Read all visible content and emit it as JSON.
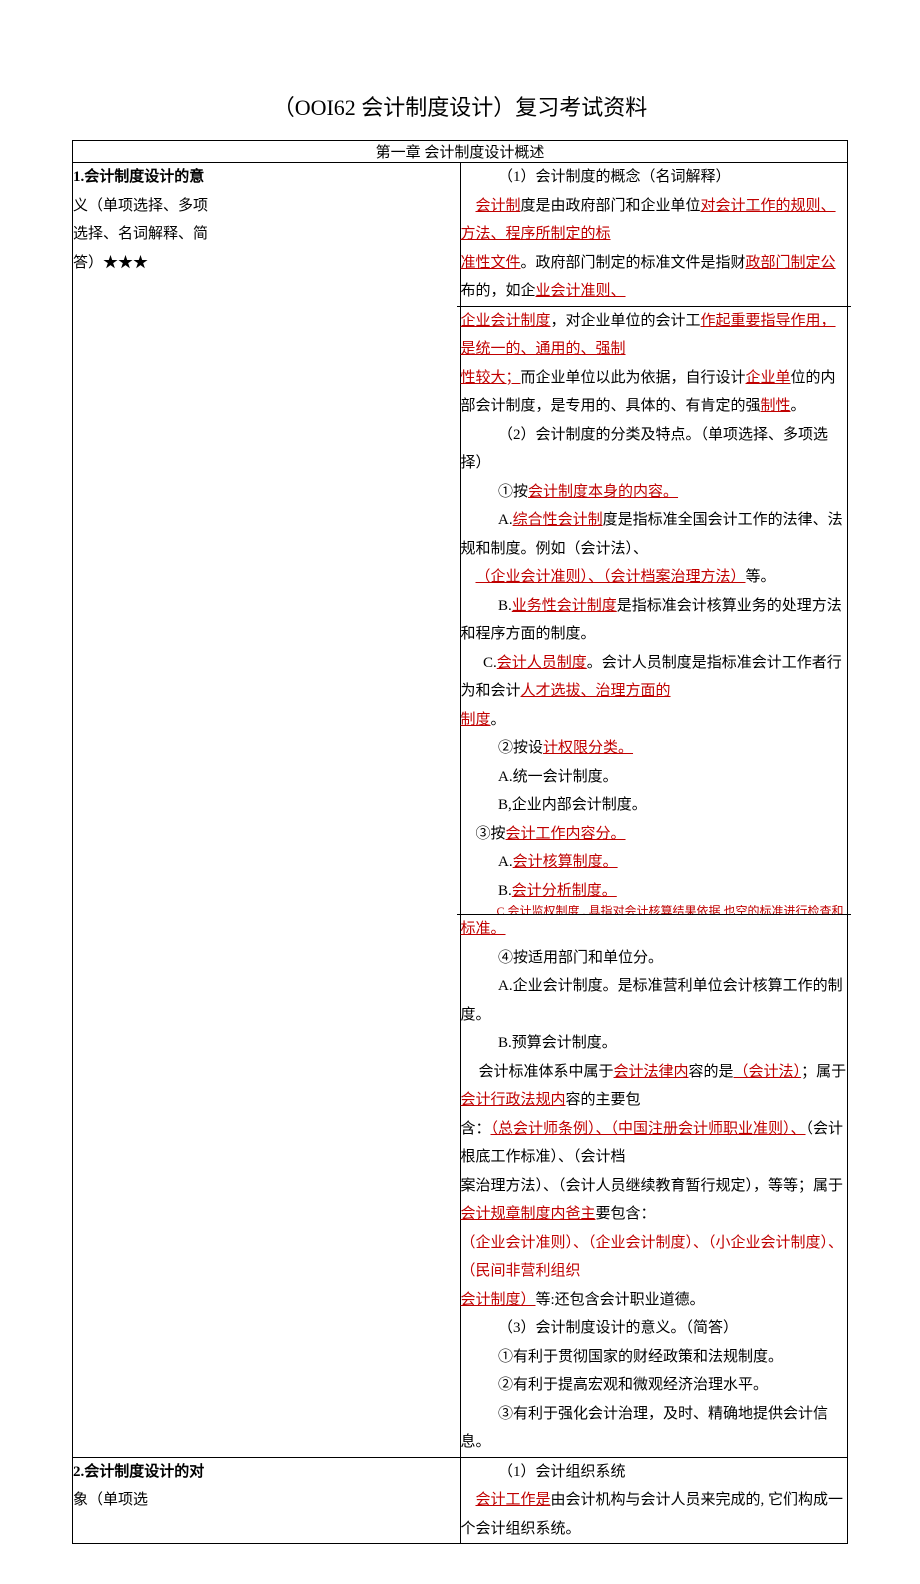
{
  "title": "（OOI62 会计制度设计）复习考试资料",
  "chapter_header": "第一章 会计制度设计概述",
  "row1_left_line1": "1.会计制度设计的意",
  "row1_left_line2a": "义（单项选择、多项",
  "row1_left_line3a": "选择、名词解释、简",
  "row1_left_line4a": "答）",
  "row1_left_stars": "★★★",
  "row1_h1": "（1）会计制度的概念（名词解释）",
  "row1_p1_a": "会计制",
  "row1_p1_b": "度是由政府部门和企业单位",
  "row1_p1_c": "对会计工作的规则、方法、程序所制定的标",
  "row1_p2_a": "准性文件",
  "row1_p2_b": "。政府部门制定的标准文件是指财",
  "row1_p2_c": "政部门制定公",
  "row1_p2_d": "布的，如企",
  "row1_p2_e": "业会计准则、",
  "row1_p3_a": "企业会计制度",
  "row1_p3_b": "，对企业单位的会计工",
  "row1_p3_c": "作起重要指导作用，是统一的、通用的、强制",
  "row1_p4_a": "性较大；",
  "row1_p4_b": "而企业单位以此为依据，自行设计",
  "row1_p4_c": "企业单",
  "row1_p4_d": "位的内部会计制度，是专用的、具体的、有肯定的强",
  "row1_p4_e": "制性",
  "row1_p4_f": "。",
  "row1_h2": "（2）会计制度的分类及特点。（单项选择、多项选择）",
  "row1_b1_a": "①按",
  "row1_b1_b": "会计制度本身的内容。",
  "row1_A_a": "A.",
  "row1_A_b": "综合性会计制",
  "row1_A_c": "度是指标准全国会计工作的法律、法规和制度。例如（会计法）、",
  "row1_A2_a": "（企业会计准则）、（会计档案治理方法）",
  "row1_A2_b": "等。",
  "row1_B_a": "B.",
  "row1_B_b": "业务性会计制度",
  "row1_B_c": "是指标准会计核算业务的处理方法和程序方面的制度。",
  "row1_C_a": "C.",
  "row1_C_b": "会计人员制度",
  "row1_C_c": "。会计人员制度是指标准会计工作者行为和会计",
  "row1_C_d": "人才选拔、治理方面的",
  "row1_C2_a": "制度",
  "row1_C2_b": "。",
  "row1_b2_a": "②按设",
  "row1_b2_b": "计权限分类。",
  "row1_b2_A": "A.统一会计制度。",
  "row1_b2_B": "B,企业内部会计制度。",
  "row1_b3_a": "③按",
  "row1_b3_b": "会计工作内容分。",
  "row1_b3_A_a": "A.",
  "row1_b3_A_b": "会计核算制度。",
  "row1_b3_B_a": "B.",
  "row1_b3_B_b": "会计分析制度。",
  "row1_cut": "C 会计监权制度 . 具指对会计核算结果依据 也空的标准进行检查和验证的会计",
  "row1_cut2_a": "标准。",
  "row1_b4": "④按适用部门和单位分。",
  "row1_b4_A": "A.企业会计制度。是标准营利单位会计核算工作的制度。",
  "row1_b4_B": "B.预算会计制度。",
  "row1_sys_a": "会计标准体系中属于",
  "row1_sys_b": "会计法律内",
  "row1_sys_c": "容的是",
  "row1_sys_d": "（会计法）",
  "row1_sys_e": "；属于",
  "row1_sys_f": "会计行政法规内",
  "row1_sys_g": "容的主要包",
  "row1_sys2_a": "含：",
  "row1_sys2_b": "（总会计师条例）、（中国注册会计师职业准则）、",
  "row1_sys2_c": "（会计根底工作标准）、（会计档",
  "row1_sys3_a": "案治理方法）、（会计人员继续教育暂行规定），等等；属于",
  "row1_sys3_b": "会计规章制度内爸主",
  "row1_sys3_c": "要包含：",
  "row1_sys4_a": "（企业会计准则）、（企业会计制度）、（小企业会计制度）、（民间非营利组织",
  "row1_sys5_a": "会计制度）",
  "row1_sys5_b": "等:还包含会计职业道德。",
  "row1_h3": "（3）会计制度设计的意义。（简答）",
  "row1_m1": "①有利于贯彻国家的财经政策和法规制度。",
  "row1_m2": "②有利于提高宏观和微观经济治理水平。",
  "row1_m3": "③有利于强化会计治理，及时、精确地提供会计信息。",
  "row2_left_l1": "2.会计制度设计的对",
  "row2_left_l2": "象（单项选",
  "row2_h1": "（1）会计组织系统",
  "row2_p1_a": "会计工作是",
  "row2_p1_b": "由会计机构与会计人员来完成的, 它们构成一个会计组织系统。"
}
